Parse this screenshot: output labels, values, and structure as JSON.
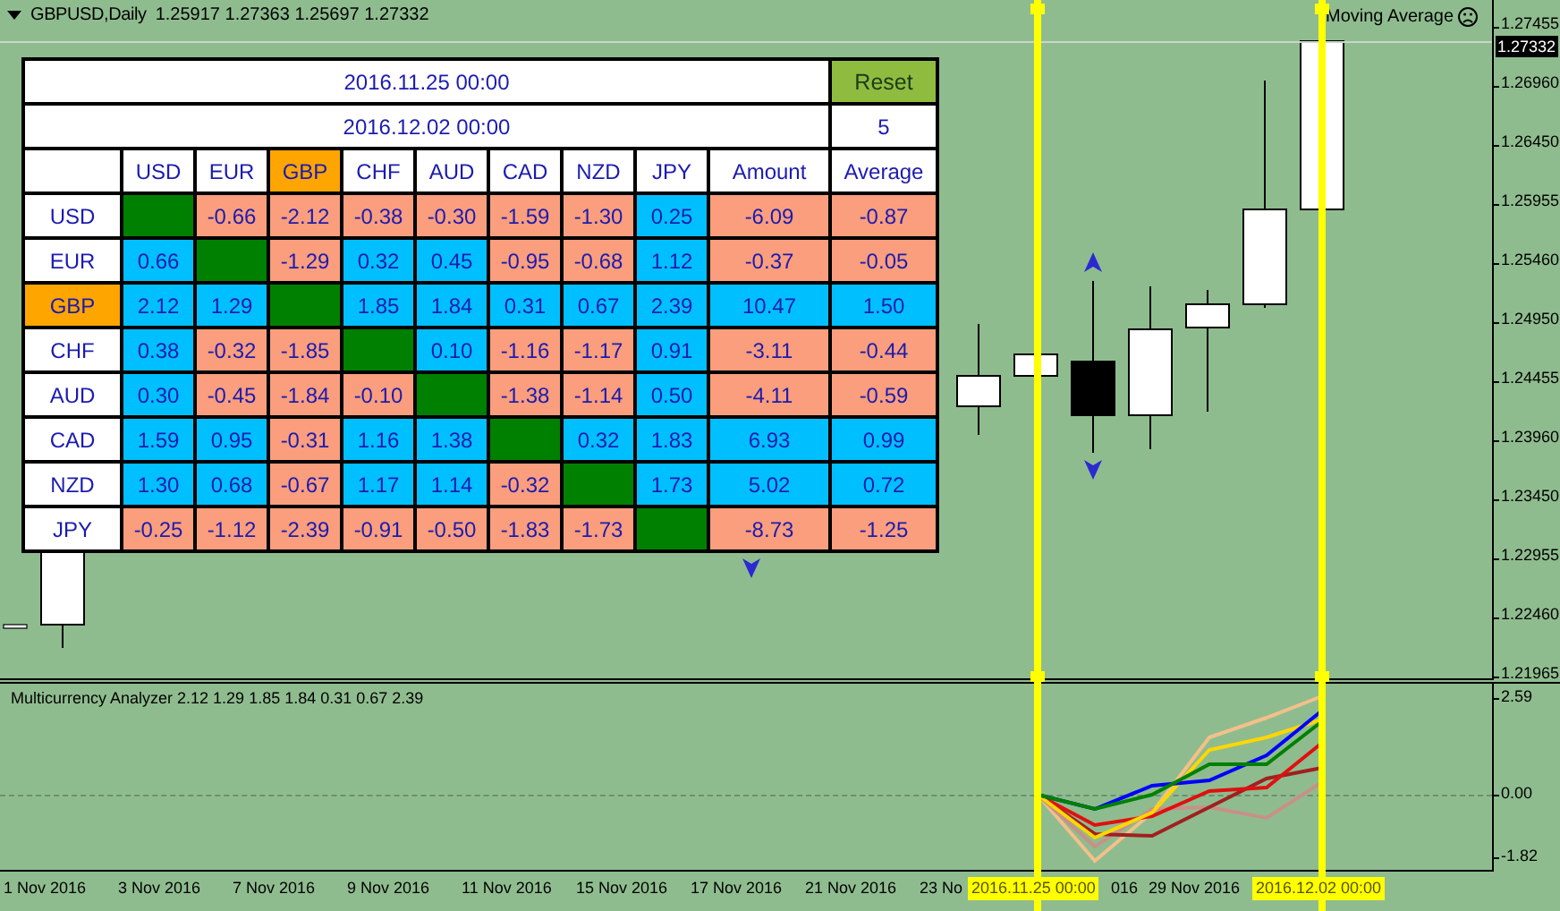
{
  "chart": {
    "symbol": "GBPUSD,Daily",
    "ohlc": "1.25917 1.27363 1.25697 1.27332",
    "indicator_label": "Moving Average",
    "current_price": "1.27332",
    "price_labels": [
      "1.27455",
      "1.26960",
      "1.26450",
      "1.25955",
      "1.25460",
      "1.24950",
      "1.24455",
      "1.23960",
      "1.23450",
      "1.22955",
      "1.22460",
      "1.21965"
    ]
  },
  "matrix": {
    "start": "2016.11.25 00:00",
    "end": "2016.12.02 00:00",
    "reset": "Reset",
    "count": "5",
    "columns": [
      {
        "label": "USD",
        "selected": false
      },
      {
        "label": "EUR",
        "selected": false
      },
      {
        "label": "GBP",
        "selected": true
      },
      {
        "label": "CHF",
        "selected": false
      },
      {
        "label": "AUD",
        "selected": false
      },
      {
        "label": "CAD",
        "selected": false
      },
      {
        "label": "NZD",
        "selected": false
      },
      {
        "label": "JPY",
        "selected": false
      },
      {
        "label": "Amount",
        "selected": false
      },
      {
        "label": "Average",
        "selected": false
      }
    ],
    "rows": [
      {
        "label": "USD",
        "selected": false,
        "cells": [
          {
            "kind": "diagonal"
          },
          {
            "kind": "negative",
            "value": "-0.66"
          },
          {
            "kind": "negative",
            "value": "-2.12"
          },
          {
            "kind": "negative",
            "value": "-0.38"
          },
          {
            "kind": "negative",
            "value": "-0.30"
          },
          {
            "kind": "negative",
            "value": "-1.59"
          },
          {
            "kind": "negative",
            "value": "-1.30"
          },
          {
            "kind": "positive",
            "value": "0.25"
          },
          {
            "kind": "negative",
            "value": "-6.09"
          },
          {
            "kind": "negative",
            "value": "-0.87"
          }
        ]
      },
      {
        "label": "EUR",
        "selected": false,
        "cells": [
          {
            "kind": "positive",
            "value": "0.66"
          },
          {
            "kind": "diagonal"
          },
          {
            "kind": "negative",
            "value": "-1.29"
          },
          {
            "kind": "positive",
            "value": "0.32"
          },
          {
            "kind": "positive",
            "value": "0.45"
          },
          {
            "kind": "negative",
            "value": "-0.95"
          },
          {
            "kind": "negative",
            "value": "-0.68"
          },
          {
            "kind": "positive",
            "value": "1.12"
          },
          {
            "kind": "negative",
            "value": "-0.37"
          },
          {
            "kind": "negative",
            "value": "-0.05"
          }
        ]
      },
      {
        "label": "GBP",
        "selected": true,
        "cells": [
          {
            "kind": "positive",
            "value": "2.12"
          },
          {
            "kind": "positive",
            "value": "1.29"
          },
          {
            "kind": "diagonal"
          },
          {
            "kind": "positive",
            "value": "1.85"
          },
          {
            "kind": "positive",
            "value": "1.84"
          },
          {
            "kind": "positive",
            "value": "0.31"
          },
          {
            "kind": "positive",
            "value": "0.67"
          },
          {
            "kind": "positive",
            "value": "2.39"
          },
          {
            "kind": "positive",
            "value": "10.47"
          },
          {
            "kind": "positive",
            "value": "1.50"
          }
        ]
      },
      {
        "label": "CHF",
        "selected": false,
        "cells": [
          {
            "kind": "positive",
            "value": "0.38"
          },
          {
            "kind": "negative",
            "value": "-0.32"
          },
          {
            "kind": "negative",
            "value": "-1.85"
          },
          {
            "kind": "diagonal"
          },
          {
            "kind": "positive",
            "value": "0.10"
          },
          {
            "kind": "negative",
            "value": "-1.16"
          },
          {
            "kind": "negative",
            "value": "-1.17"
          },
          {
            "kind": "positive",
            "value": "0.91"
          },
          {
            "kind": "negative",
            "value": "-3.11"
          },
          {
            "kind": "negative",
            "value": "-0.44"
          }
        ]
      },
      {
        "label": "AUD",
        "selected": false,
        "cells": [
          {
            "kind": "positive",
            "value": "0.30"
          },
          {
            "kind": "negative",
            "value": "-0.45"
          },
          {
            "kind": "negative",
            "value": "-1.84"
          },
          {
            "kind": "negative",
            "value": "-0.10"
          },
          {
            "kind": "diagonal"
          },
          {
            "kind": "negative",
            "value": "-1.38"
          },
          {
            "kind": "negative",
            "value": "-1.14"
          },
          {
            "kind": "positive",
            "value": "0.50"
          },
          {
            "kind": "negative",
            "value": "-4.11"
          },
          {
            "kind": "negative",
            "value": "-0.59"
          }
        ]
      },
      {
        "label": "CAD",
        "selected": false,
        "cells": [
          {
            "kind": "positive",
            "value": "1.59"
          },
          {
            "kind": "positive",
            "value": "0.95"
          },
          {
            "kind": "negative",
            "value": "-0.31"
          },
          {
            "kind": "positive",
            "value": "1.16"
          },
          {
            "kind": "positive",
            "value": "1.38"
          },
          {
            "kind": "diagonal"
          },
          {
            "kind": "positive",
            "value": "0.32"
          },
          {
            "kind": "positive",
            "value": "1.83"
          },
          {
            "kind": "positive",
            "value": "6.93"
          },
          {
            "kind": "positive",
            "value": "0.99"
          }
        ]
      },
      {
        "label": "NZD",
        "selected": false,
        "cells": [
          {
            "kind": "positive",
            "value": "1.30"
          },
          {
            "kind": "positive",
            "value": "0.68"
          },
          {
            "kind": "negative",
            "value": "-0.67"
          },
          {
            "kind": "positive",
            "value": "1.17"
          },
          {
            "kind": "positive",
            "value": "1.14"
          },
          {
            "kind": "negative",
            "value": "-0.32"
          },
          {
            "kind": "diagonal"
          },
          {
            "kind": "positive",
            "value": "1.73"
          },
          {
            "kind": "positive",
            "value": "5.02"
          },
          {
            "kind": "positive",
            "value": "0.72"
          }
        ]
      },
      {
        "label": "JPY",
        "selected": false,
        "cells": [
          {
            "kind": "negative",
            "value": "-0.25"
          },
          {
            "kind": "negative",
            "value": "-1.12"
          },
          {
            "kind": "negative",
            "value": "-2.39"
          },
          {
            "kind": "negative",
            "value": "-0.91"
          },
          {
            "kind": "negative",
            "value": "-0.50"
          },
          {
            "kind": "negative",
            "value": "-1.83"
          },
          {
            "kind": "negative",
            "value": "-1.73"
          },
          {
            "kind": "diagonal"
          },
          {
            "kind": "negative",
            "value": "-8.73"
          },
          {
            "kind": "negative",
            "value": "-1.25"
          }
        ]
      }
    ]
  },
  "indicator": {
    "title": "Multicurrency Analyzer 2.12 1.29 1.85 1.84 0.31 0.67 2.39",
    "scale_labels": [
      "2.59",
      "0.00",
      "-1.82"
    ]
  },
  "time_axis": {
    "labels": [
      "1 Nov 2016",
      "3 Nov 2016",
      "7 Nov 2016",
      "9 Nov 2016",
      "11 Nov 2016",
      "15 Nov 2016",
      "17 Nov 2016",
      "21 Nov 2016",
      "23 No",
      "016",
      "29 Nov 2016"
    ],
    "markers": [
      "2016.11.25 00:00",
      "2016.12.02 00:00"
    ]
  }
}
